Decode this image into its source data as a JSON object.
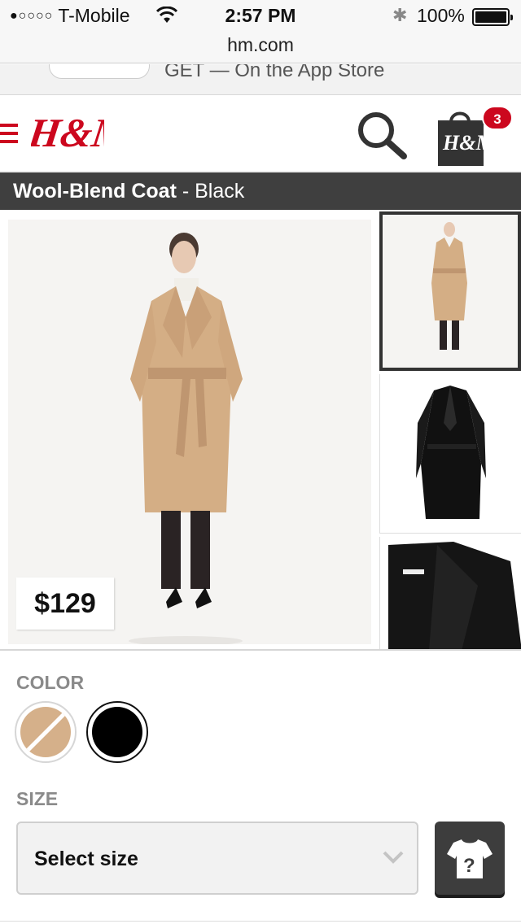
{
  "status_bar": {
    "signal_dots": "●○○○○",
    "carrier": "T-Mobile",
    "time": "2:57 PM",
    "battery_percent": "100%",
    "icons": [
      "wifi-icon",
      "bluetooth-icon",
      "battery-icon"
    ]
  },
  "browser": {
    "url": "hm.com"
  },
  "app_banner": {
    "text": "GET — On the App Store"
  },
  "header": {
    "logo_text": "H&M",
    "bag_count": "3",
    "bag_logo_text": "H&M",
    "icons": [
      "menu-icon",
      "search-icon",
      "shopping-bag-icon"
    ]
  },
  "product": {
    "name": "Wool-Blend Coat",
    "separator": " - ",
    "color_name": "Black",
    "price": "$129",
    "thumbnails": [
      "thumbnail-model-beige",
      "thumbnail-coat-black",
      "thumbnail-coat-black-detail"
    ],
    "selected_thumbnail": 1
  },
  "color": {
    "label": "COLOR",
    "swatches": [
      {
        "name": "beige",
        "hex": "#d5b08a",
        "available": false
      },
      {
        "name": "black",
        "hex": "#000000",
        "available": true,
        "selected": true
      }
    ]
  },
  "size": {
    "label": "SIZE",
    "select_value": "Select size",
    "guide_icon": "size-guide-icon"
  },
  "colors": {
    "brand_red": "#cc071e",
    "title_bar_bg": "#3f3f3f",
    "beige": "#d5b08a"
  }
}
